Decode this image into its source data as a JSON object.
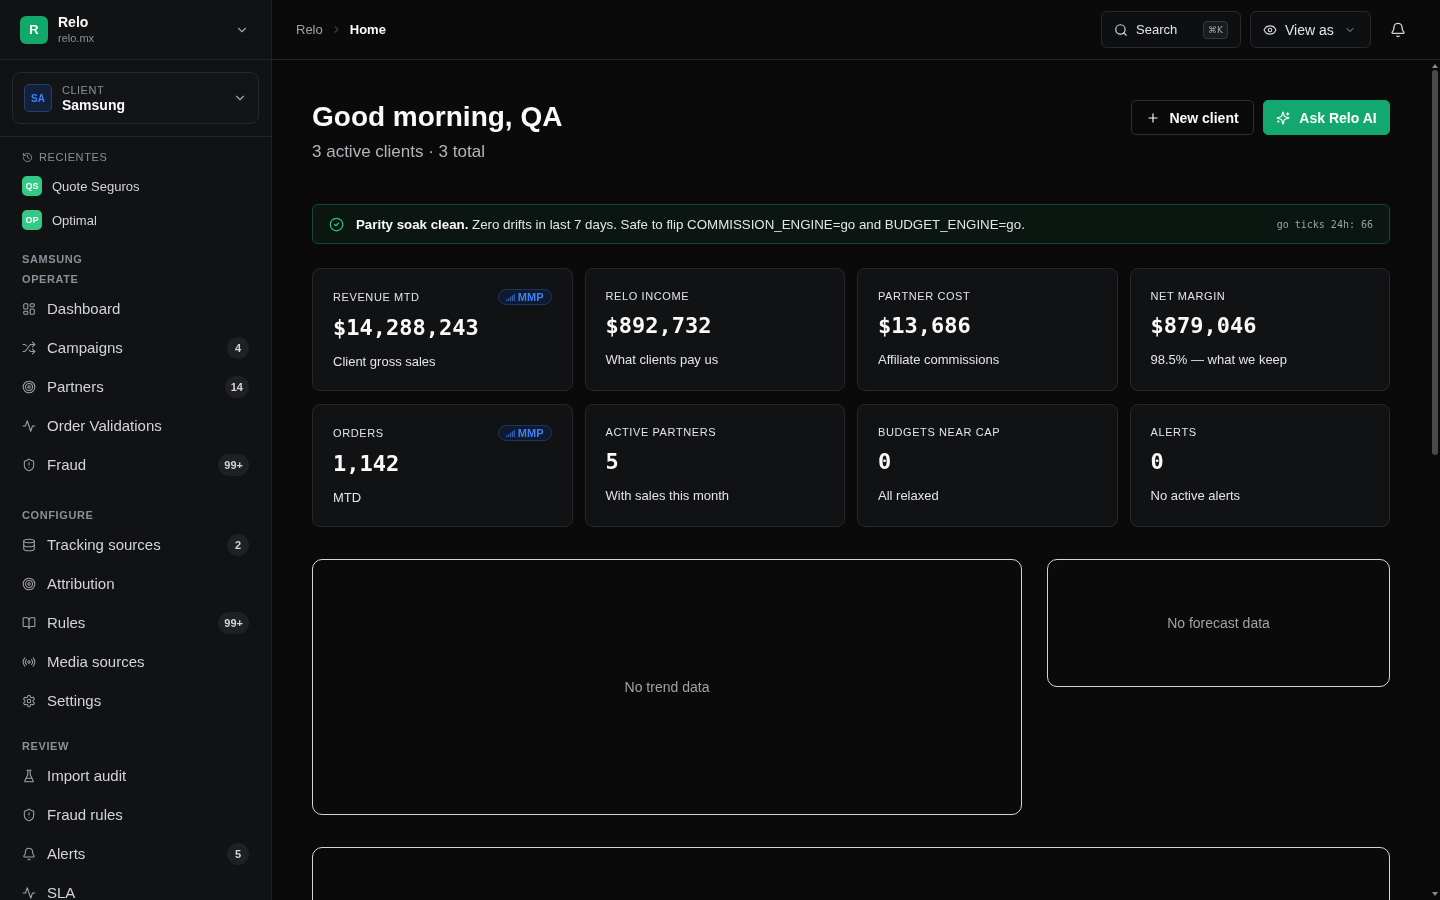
{
  "workspace": {
    "logo": "R",
    "name": "Relo",
    "domain": "relo.mx"
  },
  "client_selector": {
    "initials": "SA",
    "label": "CLIENT",
    "name": "Samsung"
  },
  "recents": {
    "title": "RECIENTES",
    "items": [
      {
        "initials": "QS",
        "name": "Quote Seguros"
      },
      {
        "initials": "OP",
        "name": "Optimal"
      }
    ]
  },
  "sidebar": {
    "client_heading": "SAMSUNG",
    "sections": [
      {
        "title": "OPERATE",
        "items": [
          {
            "label": "Dashboard"
          },
          {
            "label": "Campaigns",
            "badge": "4"
          },
          {
            "label": "Partners",
            "badge": "14"
          },
          {
            "label": "Order Validations"
          },
          {
            "label": "Fraud",
            "badge": "99+"
          }
        ]
      },
      {
        "title": "CONFIGURE",
        "items": [
          {
            "label": "Tracking sources",
            "badge": "2"
          },
          {
            "label": "Attribution"
          },
          {
            "label": "Rules",
            "badge": "99+"
          },
          {
            "label": "Media sources"
          },
          {
            "label": "Settings"
          }
        ]
      },
      {
        "title": "REVIEW",
        "items": [
          {
            "label": "Import audit"
          },
          {
            "label": "Fraud rules"
          },
          {
            "label": "Alerts",
            "badge": "5"
          },
          {
            "label": "SLA"
          }
        ]
      }
    ]
  },
  "topbar": {
    "breadcrumb": [
      "Relo",
      "Home"
    ],
    "search": {
      "label": "Search",
      "shortcut": "⌘K"
    },
    "view_as": "View as"
  },
  "header": {
    "title": "Good morning, QA",
    "subtitle": "3 active clients · 3 total",
    "actions": [
      {
        "kind": "outline",
        "label": "New client"
      },
      {
        "kind": "primary",
        "label": "Ask Relo AI"
      }
    ]
  },
  "banner": {
    "text": "**Parity soak clean.** Zero drifts in last 7 days. Safe to flip COMMISSION_ENGINE=go and BUDGET_ENGINE=go.",
    "meta": "go ticks 24h: 66"
  },
  "metrics": [
    {
      "label": "REVENUE MTD",
      "tag": "MMP",
      "value": "$14,288,243",
      "note": "Client gross sales"
    },
    {
      "label": "RELO INCOME",
      "value": "$892,732",
      "note": "What clients pay us"
    },
    {
      "label": "PARTNER COST",
      "value": "$13,686",
      "note": "Affiliate commissions"
    },
    {
      "label": "NET MARGIN",
      "value": "$879,046",
      "note": "98.5% — what we keep"
    },
    {
      "label": "ORDERS",
      "tag": "MMP",
      "value": "1,142",
      "note": "MTD"
    },
    {
      "label": "ACTIVE PARTNERS",
      "value": "5",
      "note": "With sales this month"
    },
    {
      "label": "BUDGETS NEAR CAP",
      "value": "0",
      "note": "All relaxed"
    },
    {
      "label": "ALERTS",
      "value": "0",
      "note": "No active alerts"
    }
  ],
  "panels": [
    {
      "kind": "trend",
      "message": "No trend data"
    },
    {
      "kind": "forecast",
      "message": "No forecast data"
    }
  ]
}
